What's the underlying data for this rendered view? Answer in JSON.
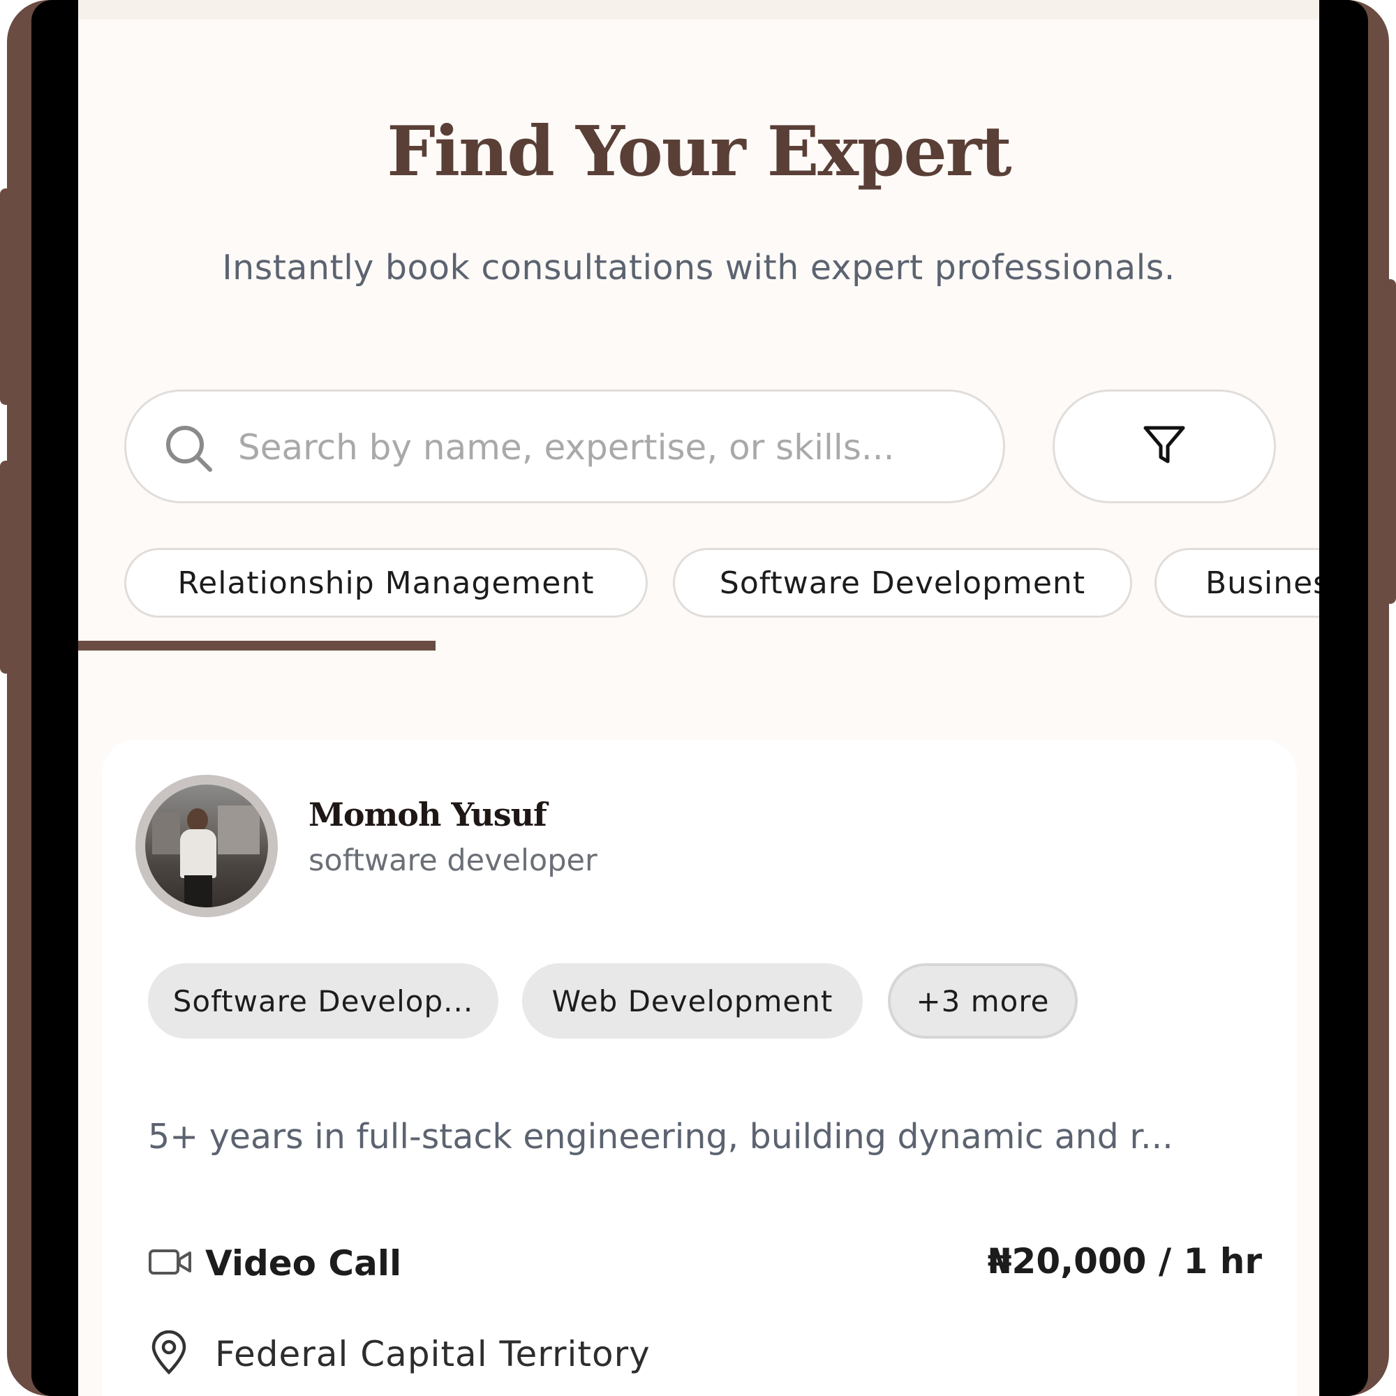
{
  "header": {
    "title": "Find Your Expert",
    "subtitle": "Instantly book consultations with expert professionals."
  },
  "search": {
    "placeholder": "Search by name, expertise, or skills...",
    "value": ""
  },
  "filter": {
    "icon": "filter-icon"
  },
  "categories": [
    {
      "label": "Relationship Management"
    },
    {
      "label": "Software Development"
    },
    {
      "label": "Business"
    }
  ],
  "expert": {
    "name": "Momoh Yusuf",
    "role": "software developer",
    "tags": [
      "Software Develop...",
      "Web Development"
    ],
    "more_tags": "+3 more",
    "bio": "5+ years in full-stack engineering, building dynamic and r...",
    "session_type": "Video Call",
    "price": "₦20,000 / 1 hr",
    "location": "Federal Capital Territory"
  },
  "colors": {
    "brand": "#6b4c42",
    "title": "#5a3f37",
    "background": "#fdfaf7",
    "tag_bg": "#e8e8e8"
  }
}
